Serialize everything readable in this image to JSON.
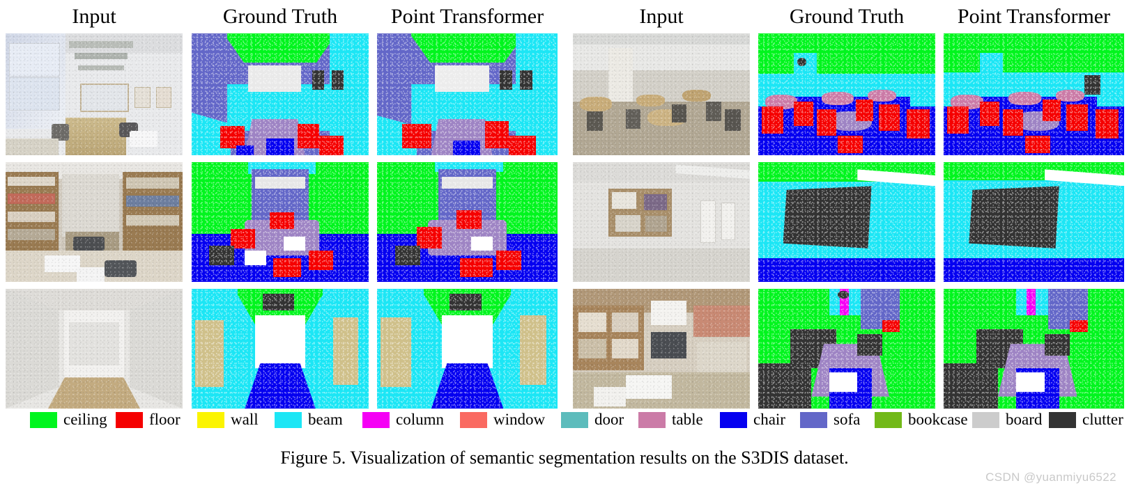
{
  "figure": {
    "caption": "Figure 5. Visualization of semantic segmentation results on the S3DIS dataset.",
    "watermark": "CSDN @yuanmiyu6522"
  },
  "columns": [
    {
      "label": "Input"
    },
    {
      "label": "Ground Truth"
    },
    {
      "label": "Point Transformer"
    },
    {
      "label": "Input"
    },
    {
      "label": "Ground Truth"
    },
    {
      "label": "Point Transformer"
    }
  ],
  "legend": {
    "items": [
      {
        "label": "ceiling",
        "color": "#00f51e"
      },
      {
        "label": "floor",
        "color": "#f50000"
      },
      {
        "label": "wall",
        "color": "#fbf400"
      },
      {
        "label": "beam",
        "color": "#1ce6f5"
      },
      {
        "label": "column",
        "color": "#f500f5"
      },
      {
        "label": "window",
        "color": "#fa6a61"
      },
      {
        "label": "door",
        "color": "#5cbcbc"
      },
      {
        "label": "table",
        "color": "#cb7ba7"
      },
      {
        "label": "chair",
        "color": "#0500f0"
      },
      {
        "label": "sofa",
        "color": "#6367c8"
      },
      {
        "label": "bookcase",
        "color": "#72b918"
      },
      {
        "label": "board",
        "color": "#cccccc"
      },
      {
        "label": "clutter",
        "color": "#333333"
      }
    ]
  },
  "panels": {
    "r1c1_input": "office room photo point cloud with windows on left, table, whiteboard",
    "r1c2_gt": "ground truth segmentation of office room",
    "r1c3_pt": "point transformer segmentation of office room",
    "r1c4_input": "open lounge area photo point cloud with tables and chairs",
    "r1c5_gt": "ground truth segmentation of lounge",
    "r1c6_pt": "point transformer segmentation of lounge",
    "r2c1_input": "library room photo point cloud with bookshelves and desk",
    "r2c2_gt": "ground truth segmentation of library",
    "r2c3_pt": "point transformer segmentation of library",
    "r2c4_input": "hallway photo point cloud with bulletin board",
    "r2c5_gt": "ground truth segmentation of hallway",
    "r2c6_pt": "point transformer segmentation of hallway",
    "r3c1_input": "corridor photo point cloud",
    "r3c2_gt": "ground truth segmentation of corridor",
    "r3c3_pt": "point transformer segmentation of corridor",
    "r3c4_input": "storage room photo point cloud with shelves and boxes",
    "r3c5_gt": "ground truth segmentation of storage room",
    "r3c6_pt": "point transformer segmentation of storage room"
  }
}
